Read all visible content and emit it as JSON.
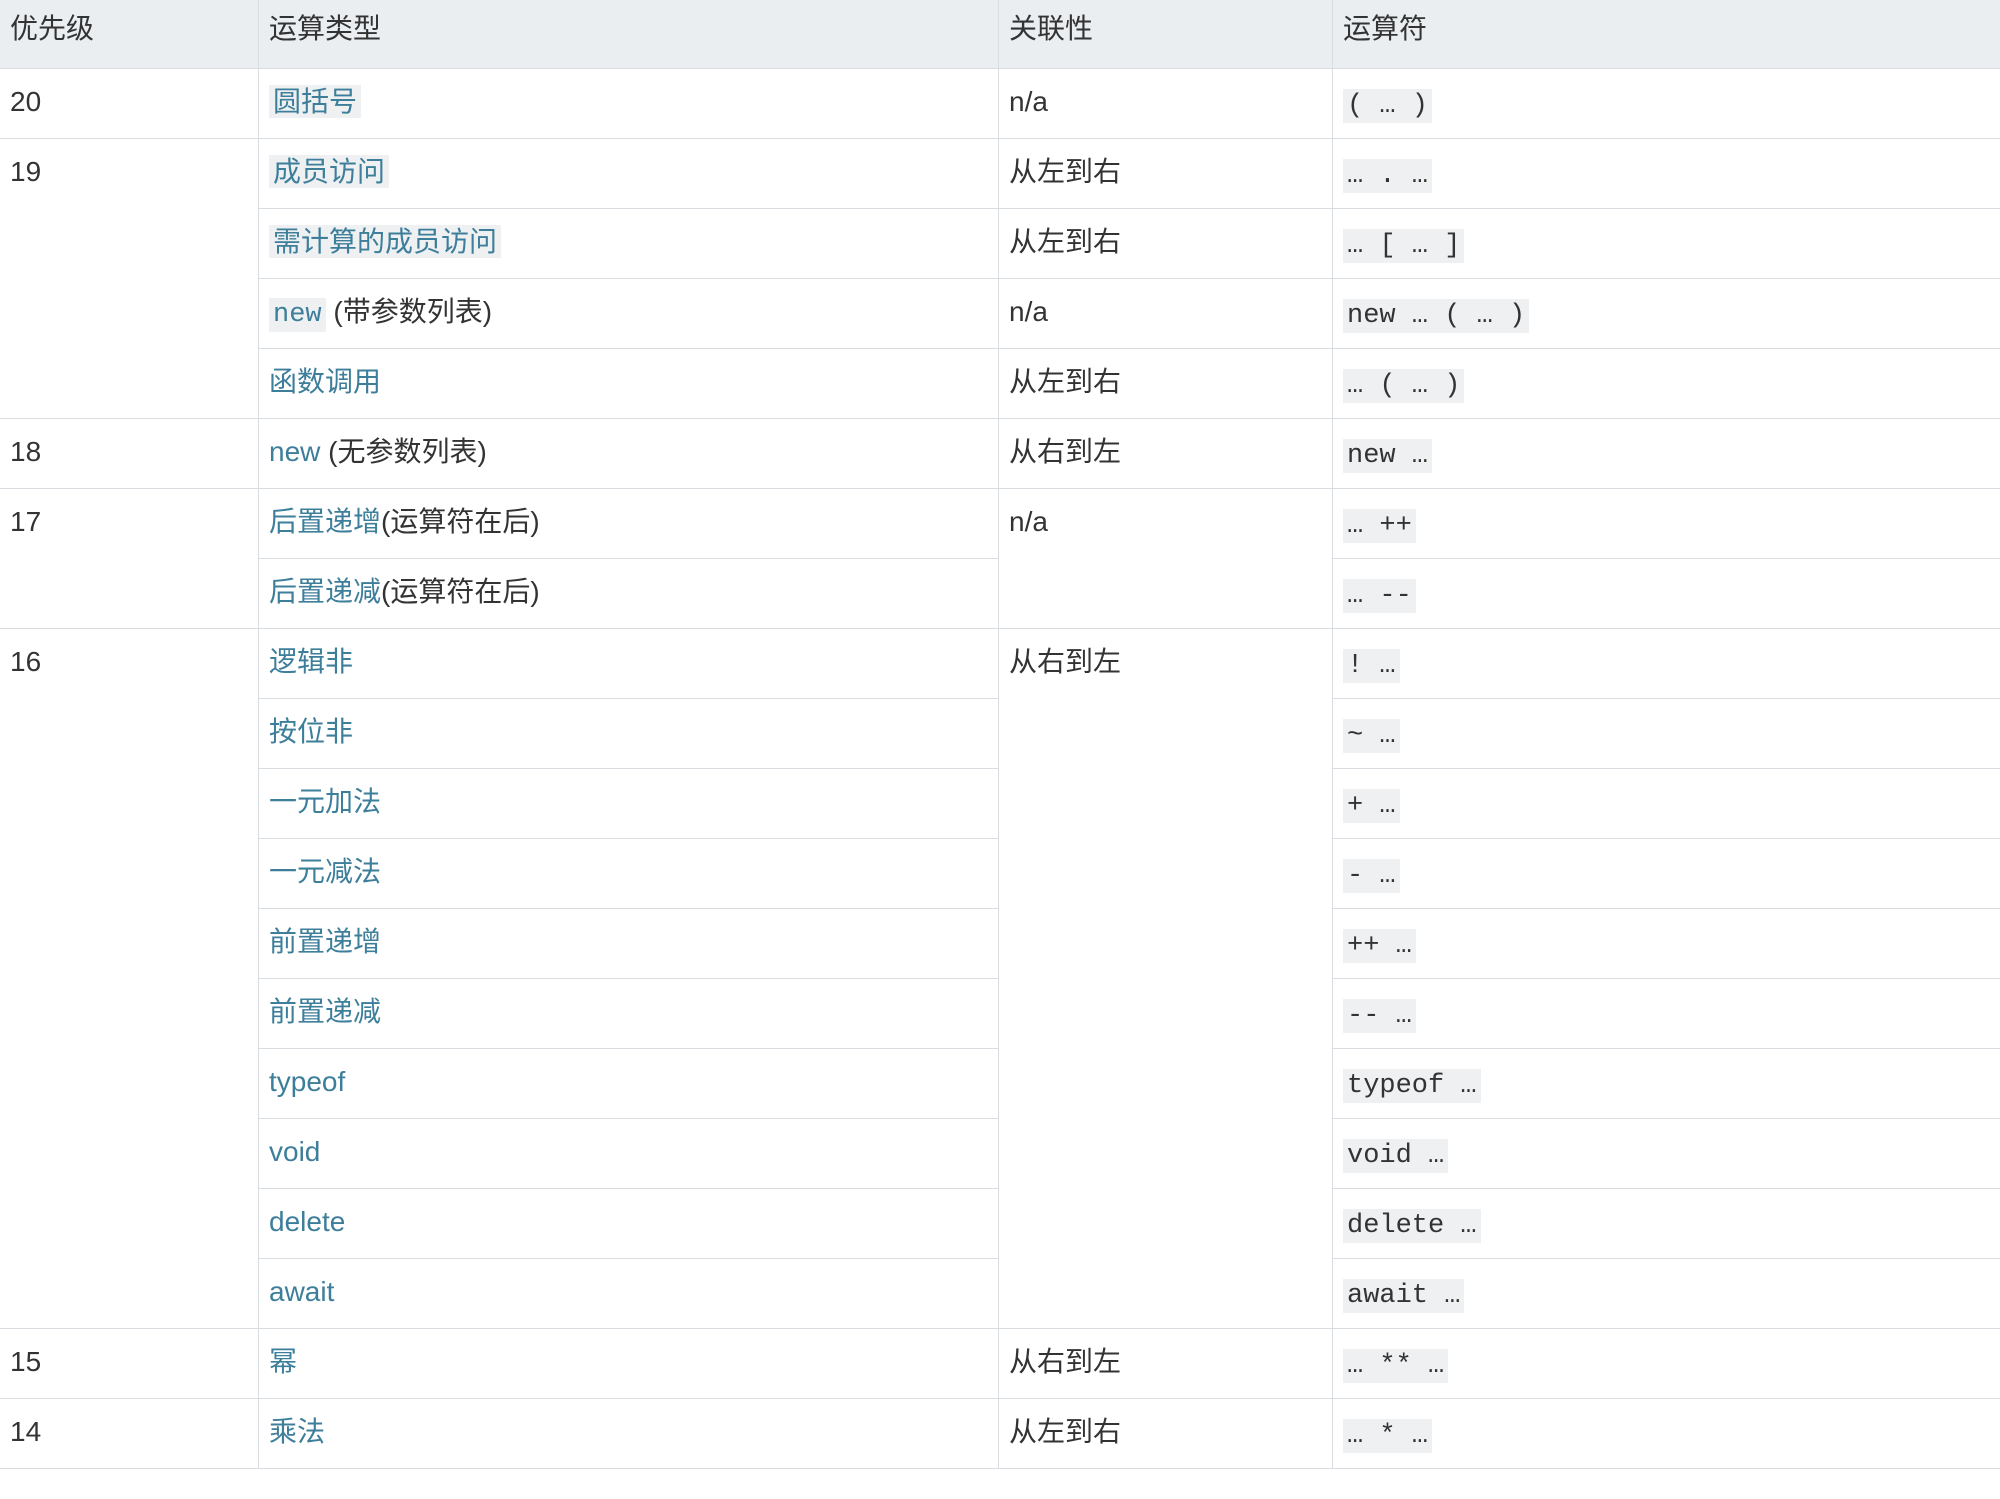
{
  "header": [
    "优先级",
    "运算类型",
    "关联性",
    "运算符"
  ],
  "rows": [
    {
      "priority": "20",
      "type": "圆括号",
      "assoc": "n/a",
      "op": "( … )"
    },
    {
      "priority": "19",
      "type": "成员访问",
      "assoc": "从左到右",
      "op": "… . …"
    },
    {
      "type": "需计算的成员访问",
      "assoc": "从左到右",
      "op": "… [ … ]"
    },
    {
      "type_code": "new",
      "type_suffix": " (带参数列表)",
      "assoc": "n/a",
      "op": "new … ( … )"
    },
    {
      "type": "函数调用",
      "assoc": "从左到右",
      "op": "… ( … )"
    },
    {
      "priority": "18",
      "type": "new",
      "type_suffix": " (无参数列表)",
      "assoc": "从右到左",
      "op": "new …"
    },
    {
      "priority": "17",
      "type": "后置递增",
      "type_suffix": "(运算符在后)",
      "assoc": "n/a",
      "op": "… ++"
    },
    {
      "type": "后置递减",
      "type_suffix": "(运算符在后)",
      "op": "… --"
    },
    {
      "priority": "16",
      "type": "逻辑非",
      "assoc": "从右到左",
      "op": "! …"
    },
    {
      "type": "按位非",
      "op": "~ …"
    },
    {
      "type": "一元加法",
      "op": "+ …"
    },
    {
      "type": "一元减法",
      "op": "- …"
    },
    {
      "type": "前置递增",
      "op": "++ …"
    },
    {
      "type": "前置递减",
      "op": "-- …"
    },
    {
      "type": "typeof",
      "op": "typeof …"
    },
    {
      "type": "void",
      "op": "void …"
    },
    {
      "type": "delete",
      "op": "delete …"
    },
    {
      "type": "await",
      "op": "await …"
    },
    {
      "priority": "15",
      "type": "幂",
      "assoc": "从右到左",
      "op": "… ** …"
    },
    {
      "priority": "14",
      "type": "乘法",
      "assoc": "从左到右",
      "op": "… * …"
    }
  ]
}
